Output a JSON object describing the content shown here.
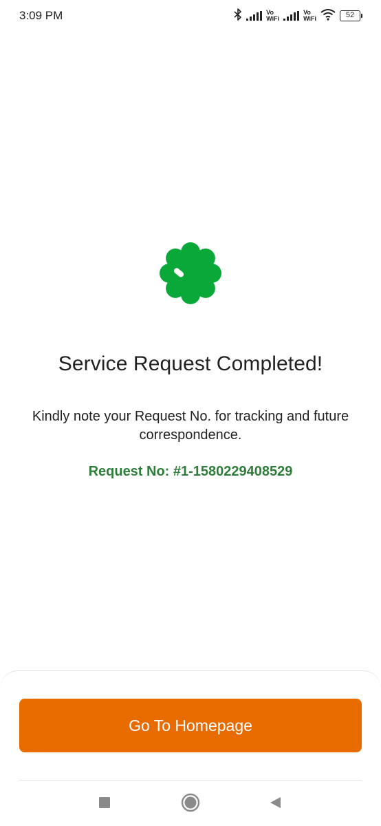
{
  "status_bar": {
    "time": "3:09 PM",
    "vowifi_top": "Vo",
    "vowifi_bottom": "WiFi",
    "battery_level": "52"
  },
  "confirmation": {
    "title": "Service Request Completed!",
    "message": "Kindly note your Request No. for tracking and future correspondence.",
    "request_number": "Request No: #1-1580229408529",
    "badge_icon": "success-badge-icon",
    "badge_color": "#0aa838"
  },
  "actions": {
    "home_label": "Go To Homepage",
    "button_color": "#e86b00"
  },
  "nav_bar": {
    "icons": [
      "recents-icon",
      "home-icon",
      "back-icon"
    ]
  }
}
